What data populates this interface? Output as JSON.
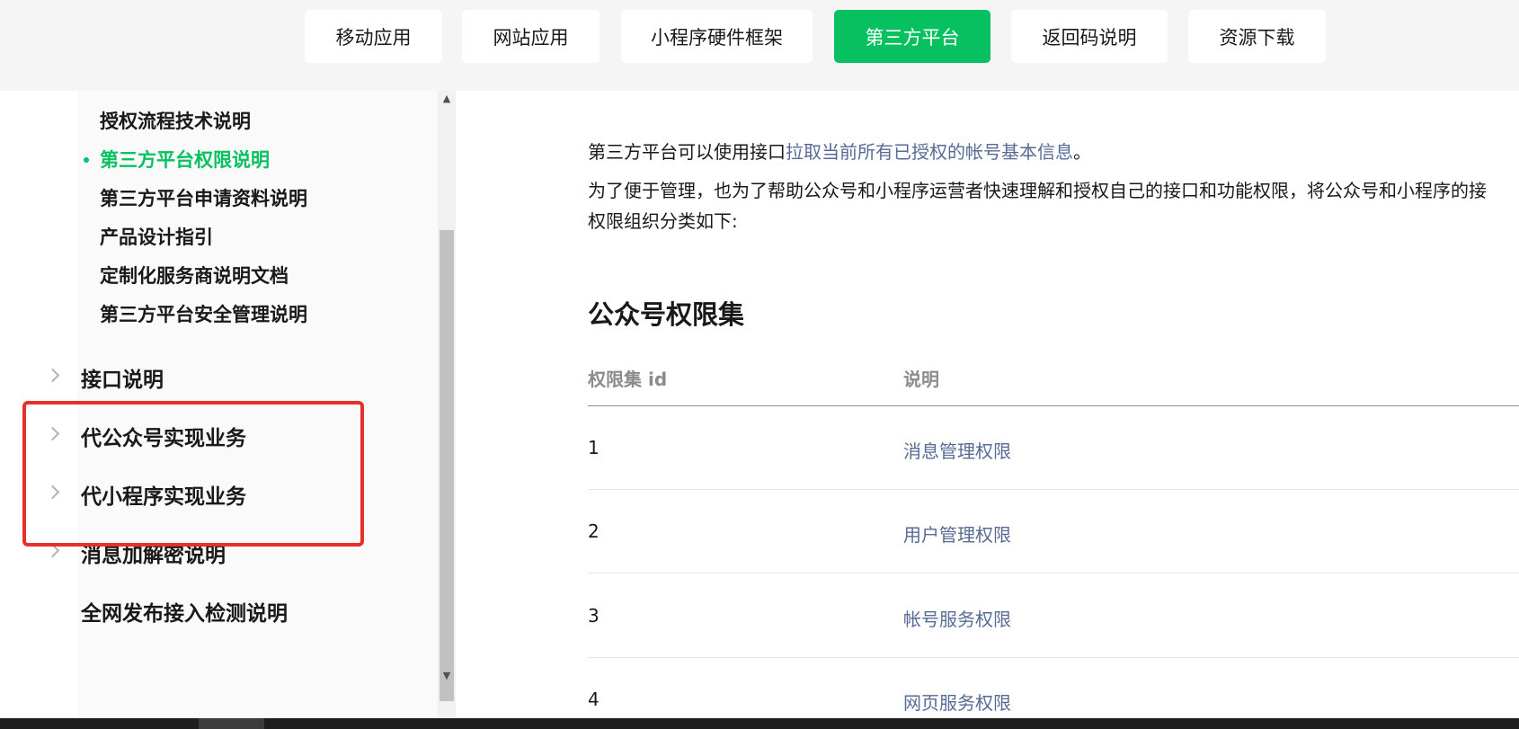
{
  "nav": {
    "tabs": [
      {
        "label": "移动应用",
        "active": false
      },
      {
        "label": "网站应用",
        "active": false
      },
      {
        "label": "小程序硬件框架",
        "active": false
      },
      {
        "label": "第三方平台",
        "active": true
      },
      {
        "label": "返回码说明",
        "active": false
      },
      {
        "label": "资源下载",
        "active": false
      }
    ]
  },
  "sidebar": {
    "sub_items": [
      {
        "label": "授权流程技术说明",
        "active": false
      },
      {
        "label": "第三方平台权限说明",
        "active": true
      },
      {
        "label": "第三方平台申请资料说明",
        "active": false
      },
      {
        "label": "产品设计指引",
        "active": false
      },
      {
        "label": "定制化服务商说明文档",
        "active": false
      },
      {
        "label": "第三方平台安全管理说明",
        "active": false
      }
    ],
    "groups": [
      {
        "label": "接口说明",
        "expandable": true
      },
      {
        "label": "代公众号实现业务",
        "expandable": true
      },
      {
        "label": "代小程序实现业务",
        "expandable": true
      },
      {
        "label": "消息加解密说明",
        "expandable": true
      },
      {
        "label": "全网发布接入检测说明",
        "expandable": false
      }
    ],
    "highlight_color": "#e8302b"
  },
  "content": {
    "intro_prefix": "第三方平台可以使用接口",
    "intro_link": "拉取当前所有已授权的帐号基本信息",
    "intro_suffix": "。",
    "para2_line1": "为了便于管理，也为了帮助公众号和小程序运营者快速理解和授权自己的接口和功能权限，将公众号和小程序的接",
    "para2_line2": "权限组织分类如下:",
    "section_title": "公众号权限集",
    "table": {
      "headers": [
        "权限集 id",
        "说明"
      ],
      "rows": [
        {
          "id": "1",
          "desc": "消息管理权限"
        },
        {
          "id": "2",
          "desc": "用户管理权限"
        },
        {
          "id": "3",
          "desc": "帐号服务权限"
        },
        {
          "id": "4",
          "desc": "网页服务权限"
        }
      ]
    }
  },
  "icons": {
    "chevron": "chevron-right-icon",
    "bullet": "bullet-dot-icon",
    "scroll_up": "scroll-up-arrow-icon",
    "scroll_down": "scroll-down-arrow-icon"
  },
  "colors": {
    "accent": "#07c160",
    "link": "#576b95",
    "highlight": "#e8302b"
  }
}
